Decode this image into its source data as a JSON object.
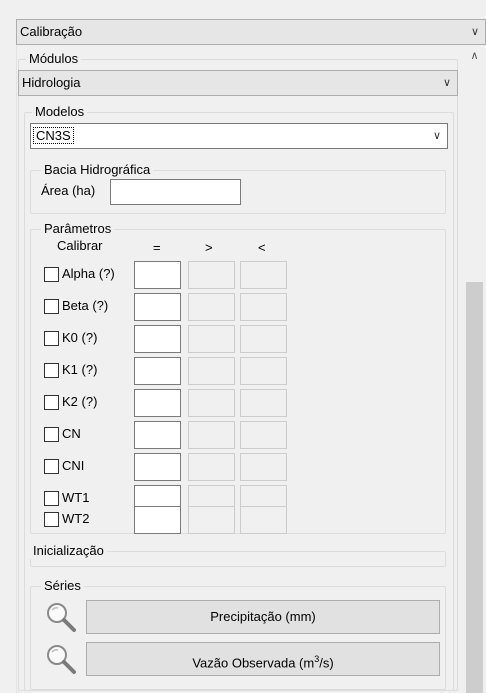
{
  "top_combo": {
    "value": "Calibração"
  },
  "modulos": {
    "label": "Módulos",
    "value": "Hidrologia"
  },
  "modelos": {
    "label": "Modelos",
    "value": "CN3S"
  },
  "bacia": {
    "label": "Bacia Hidrográfica",
    "area_label": "Área (ha)",
    "area_value": ""
  },
  "parametros": {
    "label": "Parâmetros",
    "headers": {
      "calibrar": "Calibrar",
      "eq": "=",
      "gt": ">",
      "lt": "<"
    },
    "rows": [
      {
        "name": "Alpha (?)"
      },
      {
        "name": "Beta (?)"
      },
      {
        "name": "K0 (?)"
      },
      {
        "name": "K1 (?)"
      },
      {
        "name": "K2 (?)"
      },
      {
        "name": "CN"
      },
      {
        "name": "CNI"
      },
      {
        "name": "WT1"
      },
      {
        "name": "WT2"
      }
    ]
  },
  "inicializacao": {
    "label": "Inicialização"
  },
  "series": {
    "label": "Séries",
    "precipitacao_label": "Precipitação (mm)",
    "vazao_label_prefix": "Vazão Observada (m",
    "vazao_label_sup": "3",
    "vazao_label_suffix": "/s)"
  }
}
